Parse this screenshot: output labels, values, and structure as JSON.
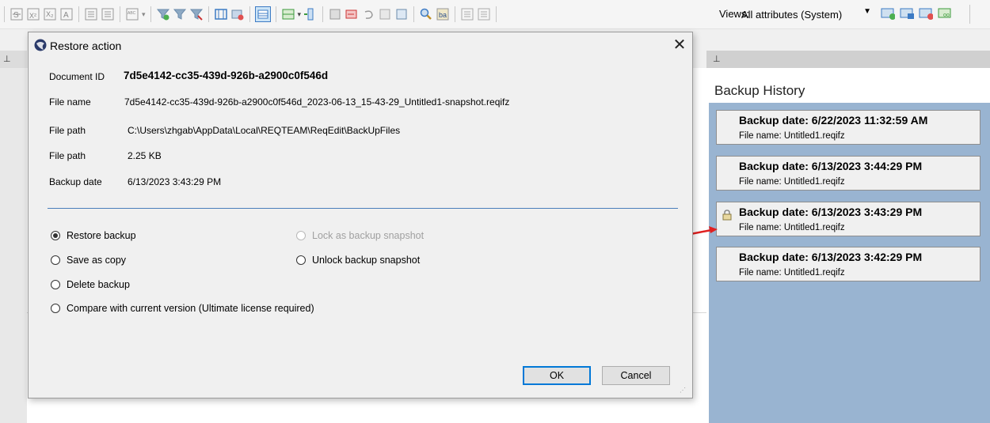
{
  "toolbar": {
    "views_label": "Views:",
    "views_value": "All attributes (System)",
    "left_icons": [
      "strikethrough-icon",
      "superscript-icon",
      "subscript-icon",
      "font-color-icon",
      "numbered-list-icon",
      "bullet-list-icon",
      "abc-icon",
      "filter-add-icon",
      "filter-icon",
      "filter-remove-icon",
      "table-icon",
      "clear-icon",
      "grid-view-icon",
      "insert-row-icon",
      "insert-col-icon",
      "merge-icon",
      "export-icon",
      "undo-icon",
      "refresh-icon",
      "sync-icon",
      "search-icon",
      "replace-icon",
      "list-left-icon",
      "list-right-icon"
    ],
    "right_icons": [
      "add-view-icon",
      "save-view-icon",
      "remove-view-icon",
      "link-view-icon"
    ]
  },
  "right_panel": {
    "title": "Backup History",
    "cards": [
      {
        "date": "Backup date: 6/22/2023 11:32:59 AM",
        "file": "File name: Untitled1.reqifz",
        "locked": false
      },
      {
        "date": "Backup date: 6/13/2023 3:44:29 PM",
        "file": "File name: Untitled1.reqifz",
        "locked": false
      },
      {
        "date": "Backup date: 6/13/2023 3:43:29 PM",
        "file": "File name: Untitled1.reqifz",
        "locked": true
      },
      {
        "date": "Backup date: 6/13/2023 3:42:29 PM",
        "file": "File name: Untitled1.reqifz",
        "locked": false
      }
    ]
  },
  "dialog": {
    "title": "Restore action",
    "fields": {
      "document_id_label": "Document ID",
      "document_id": "7d5e4142-cc35-439d-926b-a2900c0f546d",
      "file_name_label": "File name",
      "file_name": "7d5e4142-cc35-439d-926b-a2900c0f546d_2023-06-13_15-43-29_Untitled1-snapshot.reqifz",
      "file_path_label": "File path",
      "file_path": "C:\\Users\\zhgab\\AppData\\Local\\REQTEAM\\ReqEdit\\BackUpFiles",
      "file_size_label": "File path",
      "file_size": "2.25 KB",
      "backup_date_label": "Backup date",
      "backup_date": "6/13/2023 3:43:29 PM"
    },
    "options": {
      "restore": "Restore backup",
      "save_copy": "Save as copy",
      "delete": "Delete backup",
      "compare": "Compare with current version (Ultimate license required)",
      "lock": "Lock as backup snapshot",
      "unlock": "Unlock backup snapshot"
    },
    "selected": "restore",
    "ok": "OK",
    "cancel": "Cancel"
  }
}
